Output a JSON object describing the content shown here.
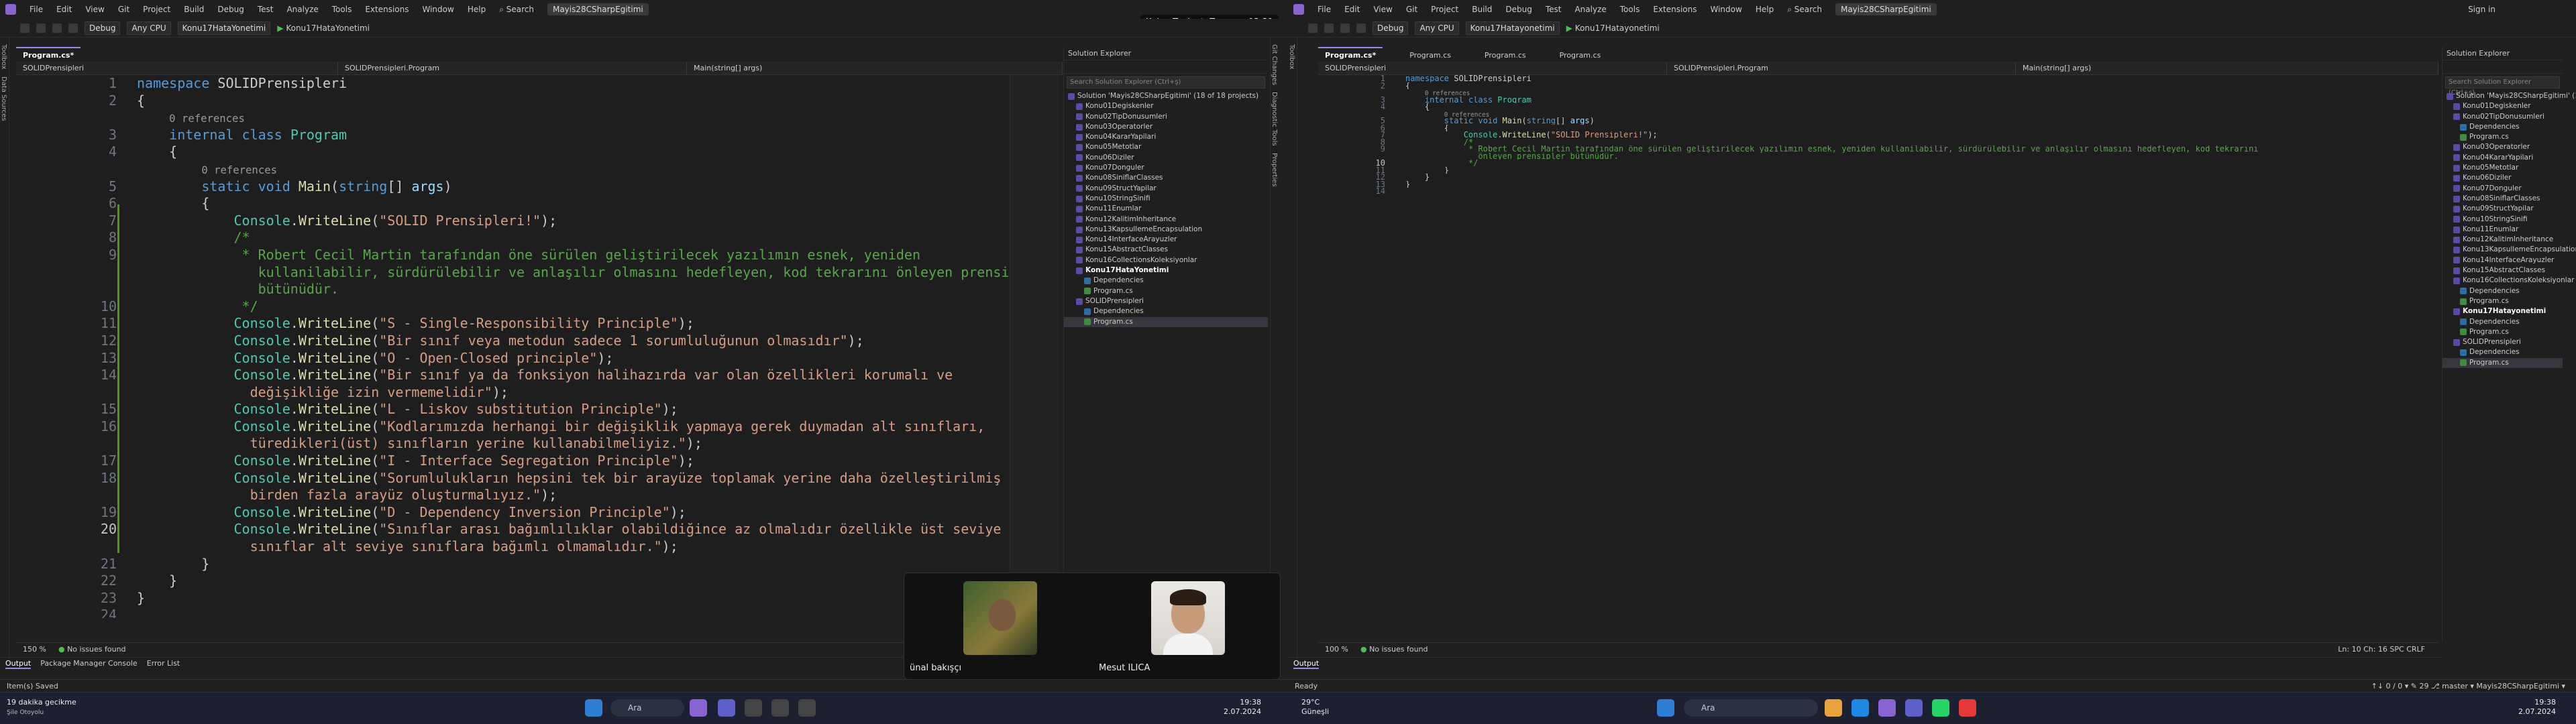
{
  "meeting_timer": "Kalan Toplantı Zamanı: 03:31",
  "menu": [
    "File",
    "Edit",
    "View",
    "Git",
    "Project",
    "Build",
    "Debug",
    "Test",
    "Analyze",
    "Tools",
    "Extensions",
    "Window",
    "Help"
  ],
  "search_label": "Search",
  "solution_title": "Mayis28CSharpEgitimi",
  "sign_in": "Sign in",
  "toolbar": {
    "config": "Debug",
    "platform": "Any CPU",
    "startup1": "Konu17HataYonetimi",
    "run1": "Konu17HataYonetimi",
    "startup2": "Konu17Hatayonetimi",
    "run2": "Konu17Hatayonetimi"
  },
  "side_tabs_left": [
    "Toolbox",
    "Data Sources"
  ],
  "side_tabs_right": [
    "Git Changes",
    "Diagnostic Tools",
    "Properties"
  ],
  "editor1": {
    "tabs": [
      "Program.cs*"
    ],
    "nav": [
      "SOLIDPrensipleri",
      "SOLIDPrensipleri.Program",
      "Main(string[] args)"
    ],
    "zoom": "150 %",
    "issues": "No issues found",
    "lines": [
      {
        "n": "1",
        "html": "<span class='kw'>namespace</span> SOLIDPrensipleri"
      },
      {
        "n": "2",
        "html": "{"
      },
      {
        "n": "",
        "html": "    <span class='ref'>0 references</span>"
      },
      {
        "n": "3",
        "html": "    <span class='kw'>internal</span> <span class='kw'>class</span> <span class='ty'>Program</span>"
      },
      {
        "n": "4",
        "html": "    {"
      },
      {
        "n": "",
        "html": "        <span class='ref'>0 references</span>"
      },
      {
        "n": "5",
        "html": "        <span class='kw'>static</span> <span class='kw'>void</span> <span class='fn'>Main</span>(<span class='kw'>string</span>[] <span class='pm'>args</span>)"
      },
      {
        "n": "6",
        "html": "        {"
      },
      {
        "n": "7",
        "html": "            <span class='ty'>Console</span>.<span class='fn'>WriteLine</span>(<span class='st'>\"SOLID Prensipleri!\"</span>);"
      },
      {
        "n": "8",
        "html": "            <span class='cm'>/*</span>"
      },
      {
        "n": "9",
        "html": "             <span class='cm'>* Robert Cecil Martin tarafından öne sürülen geliştirilecek yazılımın esnek, yeniden</span>"
      },
      {
        "n": "",
        "html": "               <span class='cm'>kullanilabilir, sürdürülebilir ve anlaşılır olmasını hedefleyen, kod tekrarını önleyen prensipler</span>"
      },
      {
        "n": "",
        "html": "               <span class='cm'>bütünüdür.</span>"
      },
      {
        "n": "10",
        "html": "             <span class='cm'>*/</span>"
      },
      {
        "n": "11",
        "html": "            <span class='ty'>Console</span>.<span class='fn'>WriteLine</span>(<span class='st'>\"S - Single-Responsibility Principle\"</span>);"
      },
      {
        "n": "12",
        "html": "            <span class='ty'>Console</span>.<span class='fn'>WriteLine</span>(<span class='st'>\"Bir sınıf veya metodun sadece 1 sorumluluğunun olmasıdır\"</span>);"
      },
      {
        "n": "13",
        "html": "            <span class='ty'>Console</span>.<span class='fn'>WriteLine</span>(<span class='st'>\"O - Open-Closed principle\"</span>);"
      },
      {
        "n": "14",
        "html": "            <span class='ty'>Console</span>.<span class='fn'>WriteLine</span>(<span class='st'>\"Bir sınıf ya da fonksiyon halihazırda var olan özellikleri korumalı ve</span>"
      },
      {
        "n": "",
        "html": "              <span class='st'>değişikliğe izin vermemelidir\"</span>);"
      },
      {
        "n": "15",
        "html": "            <span class='ty'>Console</span>.<span class='fn'>WriteLine</span>(<span class='st'>\"L - Liskov substitution Principle\"</span>);"
      },
      {
        "n": "16",
        "html": "            <span class='ty'>Console</span>.<span class='fn'>WriteLine</span>(<span class='st'>\"Kodlarımızda herhangi bir değişiklik yapmaya gerek duymadan alt sınıfları,</span>"
      },
      {
        "n": "",
        "html": "              <span class='st'>türedikleri(üst) sınıfların yerine kullanabilmeliyiz.\"</span>);"
      },
      {
        "n": "17",
        "html": "            <span class='ty'>Console</span>.<span class='fn'>WriteLine</span>(<span class='st'>\"I - Interface Segregation Principle\"</span>);"
      },
      {
        "n": "18",
        "html": "            <span class='ty'>Console</span>.<span class='fn'>WriteLine</span>(<span class='st'>\"Sorumlulukların hepsini tek bir arayüze toplamak yerine daha özelleştirilmiş</span>"
      },
      {
        "n": "",
        "html": "              <span class='st'>birden fazla arayüz oluşturmalıyız.\"</span>);"
      },
      {
        "n": "19",
        "html": "            <span class='ty'>Console</span>.<span class='fn'>WriteLine</span>(<span class='st'>\"D - Dependency Inversion Principle\"</span>);"
      },
      {
        "n": "20",
        "html": "            <span class='ty'>Console</span>.<span class='fn'>WriteLine</span>(<span class='st'>\"Sınıflar arası bağımlılıklar olabildiğince az olmalıdır özellikle üst seviye</span>"
      },
      {
        "n": "",
        "html": "              <span class='st'>sınıflar alt seviye sınıflara bağımlı olmamalıdır.\"</span>);"
      },
      {
        "n": "21",
        "html": "        }"
      },
      {
        "n": "22",
        "html": "    }"
      },
      {
        "n": "23",
        "html": "}"
      },
      {
        "n": "24",
        "html": ""
      }
    ]
  },
  "editor2": {
    "tabs": [
      "Program.cs*",
      "Program.cs",
      "Program.cs",
      "Program.cs"
    ],
    "nav": [
      "SOLIDPrensipleri",
      "SOLIDPrensipleri.Program",
      "Main(string[] args)"
    ],
    "zoom": "100 %",
    "issues": "No issues found",
    "position": "Ln: 10   Ch: 16   SPC   CRLF",
    "lines": [
      {
        "n": "1",
        "html": "<span class='kw'>namespace</span> SOLIDPrensipleri"
      },
      {
        "n": "2",
        "html": "{"
      },
      {
        "n": "",
        "html": "    <span class='ref'>0 references</span>"
      },
      {
        "n": "3",
        "html": "    <span class='kw'>internal</span> <span class='kw'>class</span> <span class='ty'>Program</span>"
      },
      {
        "n": "4",
        "html": "    {"
      },
      {
        "n": "",
        "html": "        <span class='ref'>0 references</span>"
      },
      {
        "n": "5",
        "html": "        <span class='kw'>static</span> <span class='kw'>void</span> <span class='fn'>Main</span>(<span class='kw'>string</span>[] <span class='pm'>args</span>)"
      },
      {
        "n": "6",
        "html": "        {"
      },
      {
        "n": "7",
        "html": "            <span class='ty'>Console</span>.<span class='fn'>WriteLine</span>(<span class='st'>\"SOLID Prensipleri!\"</span>);"
      },
      {
        "n": "8",
        "html": "            <span class='cm'>/*</span>"
      },
      {
        "n": "9",
        "html": "             <span class='cm'>* Robert Cecil Martin tarafından öne sürülen geliştirilecek yazılımın esnek, yeniden kullanilabilir, sürdürülebilir ve anlaşılır olmasını hedefleyen, kod tekrarını</span>"
      },
      {
        "n": "",
        "html": "               <span class='cm'>önleyen prensipler bütünüdür.</span>"
      },
      {
        "n": "10",
        "html": "             <span class='cm'>*/</span>"
      },
      {
        "n": "11",
        "html": "        }"
      },
      {
        "n": "12",
        "html": "    }"
      },
      {
        "n": "13",
        "html": "}"
      },
      {
        "n": "14",
        "html": ""
      }
    ]
  },
  "solution_explorer": {
    "title": "Solution Explorer",
    "search": "Search Solution Explorer (Ctrl+ş)",
    "items1": [
      {
        "t": "Solution 'Mayis28CSharpEgitimi' (18 of 18 projects)",
        "lvl": 0,
        "k": "sln"
      },
      {
        "t": "Konu01Degiskenler",
        "lvl": 1,
        "k": "proj"
      },
      {
        "t": "Konu02TipDonusumleri",
        "lvl": 1,
        "k": "proj"
      },
      {
        "t": "Konu03Operatorler",
        "lvl": 1,
        "k": "proj"
      },
      {
        "t": "Konu04KararYapilari",
        "lvl": 1,
        "k": "proj"
      },
      {
        "t": "Konu05Metotlar",
        "lvl": 1,
        "k": "proj"
      },
      {
        "t": "Konu06Diziler",
        "lvl": 1,
        "k": "proj"
      },
      {
        "t": "Konu07Donguler",
        "lvl": 1,
        "k": "proj"
      },
      {
        "t": "Konu08SiniflarClasses",
        "lvl": 1,
        "k": "proj"
      },
      {
        "t": "Konu09StructYapilar",
        "lvl": 1,
        "k": "proj"
      },
      {
        "t": "Konu10StringSinifi",
        "lvl": 1,
        "k": "proj"
      },
      {
        "t": "Konu11Enumlar",
        "lvl": 1,
        "k": "proj"
      },
      {
        "t": "Konu12KalitimInheritance",
        "lvl": 1,
        "k": "proj"
      },
      {
        "t": "Konu13KapsullemeEncapsulation",
        "lvl": 1,
        "k": "proj"
      },
      {
        "t": "Konu14InterfaceArayuzler",
        "lvl": 1,
        "k": "proj"
      },
      {
        "t": "Konu15AbstractClasses",
        "lvl": 1,
        "k": "proj"
      },
      {
        "t": "Konu16CollectionsKoleksiyonlar",
        "lvl": 1,
        "k": "proj"
      },
      {
        "t": "Konu17HataYonetimi",
        "lvl": 1,
        "k": "proj",
        "b": true
      },
      {
        "t": "Dependencies",
        "lvl": 2,
        "k": "dep"
      },
      {
        "t": "Program.cs",
        "lvl": 2,
        "k": "cs"
      },
      {
        "t": "SOLIDPrensipleri",
        "lvl": 1,
        "k": "proj"
      },
      {
        "t": "Dependencies",
        "lvl": 2,
        "k": "dep"
      },
      {
        "t": "Program.cs",
        "lvl": 2,
        "k": "cs",
        "s": true
      }
    ],
    "items2": [
      {
        "t": "Solution 'Mayis28CSharpEgitimi' (18 of 18 projects)",
        "lvl": 0,
        "k": "sln"
      },
      {
        "t": "Konu01Degiskenler",
        "lvl": 1,
        "k": "proj"
      },
      {
        "t": "Konu02TipDonusumleri",
        "lvl": 1,
        "k": "proj"
      },
      {
        "t": "Dependencies",
        "lvl": 2,
        "k": "dep"
      },
      {
        "t": "Program.cs",
        "lvl": 2,
        "k": "cs"
      },
      {
        "t": "Konu03Operatorler",
        "lvl": 1,
        "k": "proj"
      },
      {
        "t": "Konu04KararYapilari",
        "lvl": 1,
        "k": "proj"
      },
      {
        "t": "Konu05Metotlar",
        "lvl": 1,
        "k": "proj"
      },
      {
        "t": "Konu06Diziler",
        "lvl": 1,
        "k": "proj"
      },
      {
        "t": "Konu07Donguler",
        "lvl": 1,
        "k": "proj"
      },
      {
        "t": "Konu08SiniflarClasses",
        "lvl": 1,
        "k": "proj"
      },
      {
        "t": "Konu09StructYapilar",
        "lvl": 1,
        "k": "proj"
      },
      {
        "t": "Konu10StringSinifi",
        "lvl": 1,
        "k": "proj"
      },
      {
        "t": "Konu11Enumlar",
        "lvl": 1,
        "k": "proj"
      },
      {
        "t": "Konu12KalitimInheritance",
        "lvl": 1,
        "k": "proj"
      },
      {
        "t": "Konu13KapsullemeEncapsulation",
        "lvl": 1,
        "k": "proj"
      },
      {
        "t": "Konu14InterfaceArayuzler",
        "lvl": 1,
        "k": "proj"
      },
      {
        "t": "Konu15AbstractClasses",
        "lvl": 1,
        "k": "proj"
      },
      {
        "t": "Konu16CollectionsKoleksiyonlar",
        "lvl": 1,
        "k": "proj"
      },
      {
        "t": "Dependencies",
        "lvl": 2,
        "k": "dep"
      },
      {
        "t": "Program.cs",
        "lvl": 2,
        "k": "cs"
      },
      {
        "t": "Konu17Hatayonetimi",
        "lvl": 1,
        "k": "proj",
        "b": true
      },
      {
        "t": "Dependencies",
        "lvl": 2,
        "k": "dep"
      },
      {
        "t": "Program.cs",
        "lvl": 2,
        "k": "cs"
      },
      {
        "t": "SOLIDPrensipleri",
        "lvl": 1,
        "k": "proj"
      },
      {
        "t": "Dependencies",
        "lvl": 2,
        "k": "dep"
      },
      {
        "t": "Program.cs",
        "lvl": 2,
        "k": "cs",
        "s": true
      }
    ]
  },
  "output_tabs1": [
    "Output",
    "Package Manager Console",
    "Error List"
  ],
  "output_tabs2": [
    "Output"
  ],
  "status1": "Item(s) Saved",
  "status2": "Ready",
  "status_right2": "↑↓ 0 / 0 ▾   ✎ 29   ⎇ master ▾   Mayis28CSharpEgitimi ▾",
  "teams": {
    "p1": "ünal bakışçı",
    "p2": "Mesut ILICA"
  },
  "taskbar": {
    "notice_title": "19 dakika gecikme",
    "notice_sub": "Şile Otoyolu",
    "search": "Ara",
    "clock1_time": "19:38",
    "clock1_date": "2.07.2024",
    "clock2_time": "19:38",
    "clock2_date": "2.07.2024",
    "weather_temp": "29°C",
    "weather_desc": "Güneşli"
  }
}
